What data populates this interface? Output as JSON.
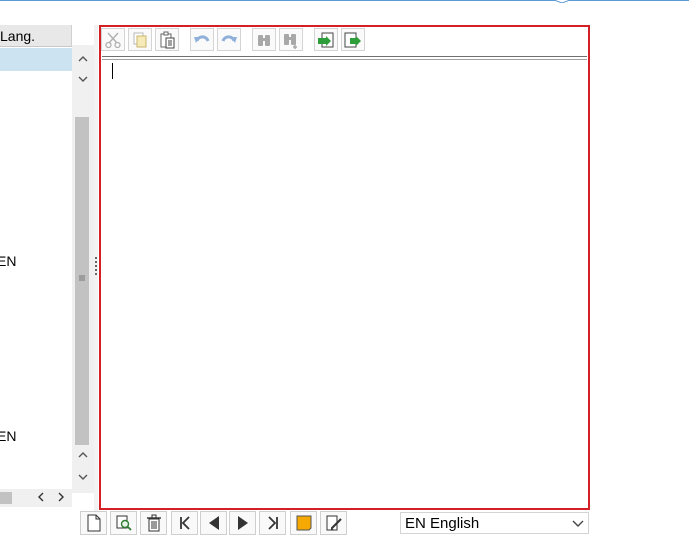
{
  "left_table": {
    "column_header": "Lang.",
    "rows": [
      {
        "label": "EN"
      },
      {
        "label": "EN"
      }
    ]
  },
  "editor": {
    "toolbar_icons": [
      "cut-icon",
      "copy-icon",
      "paste-icon",
      "undo-icon",
      "redo-icon",
      "find-icon",
      "find-next-icon",
      "load-local-file-icon",
      "save-local-file-icon"
    ],
    "text": ""
  },
  "bottom_toolbar": {
    "icons": [
      "new-document-icon",
      "search-document-icon",
      "delete-icon",
      "first-page-icon",
      "previous-page-icon",
      "next-page-icon",
      "last-page-icon",
      "note-icon",
      "edit-document-icon"
    ],
    "language": {
      "selected": "EN English"
    }
  },
  "colors": {
    "editor_border": "#d31f26",
    "selection": "#cce4f1",
    "accent_line": "#5b9bd5"
  }
}
